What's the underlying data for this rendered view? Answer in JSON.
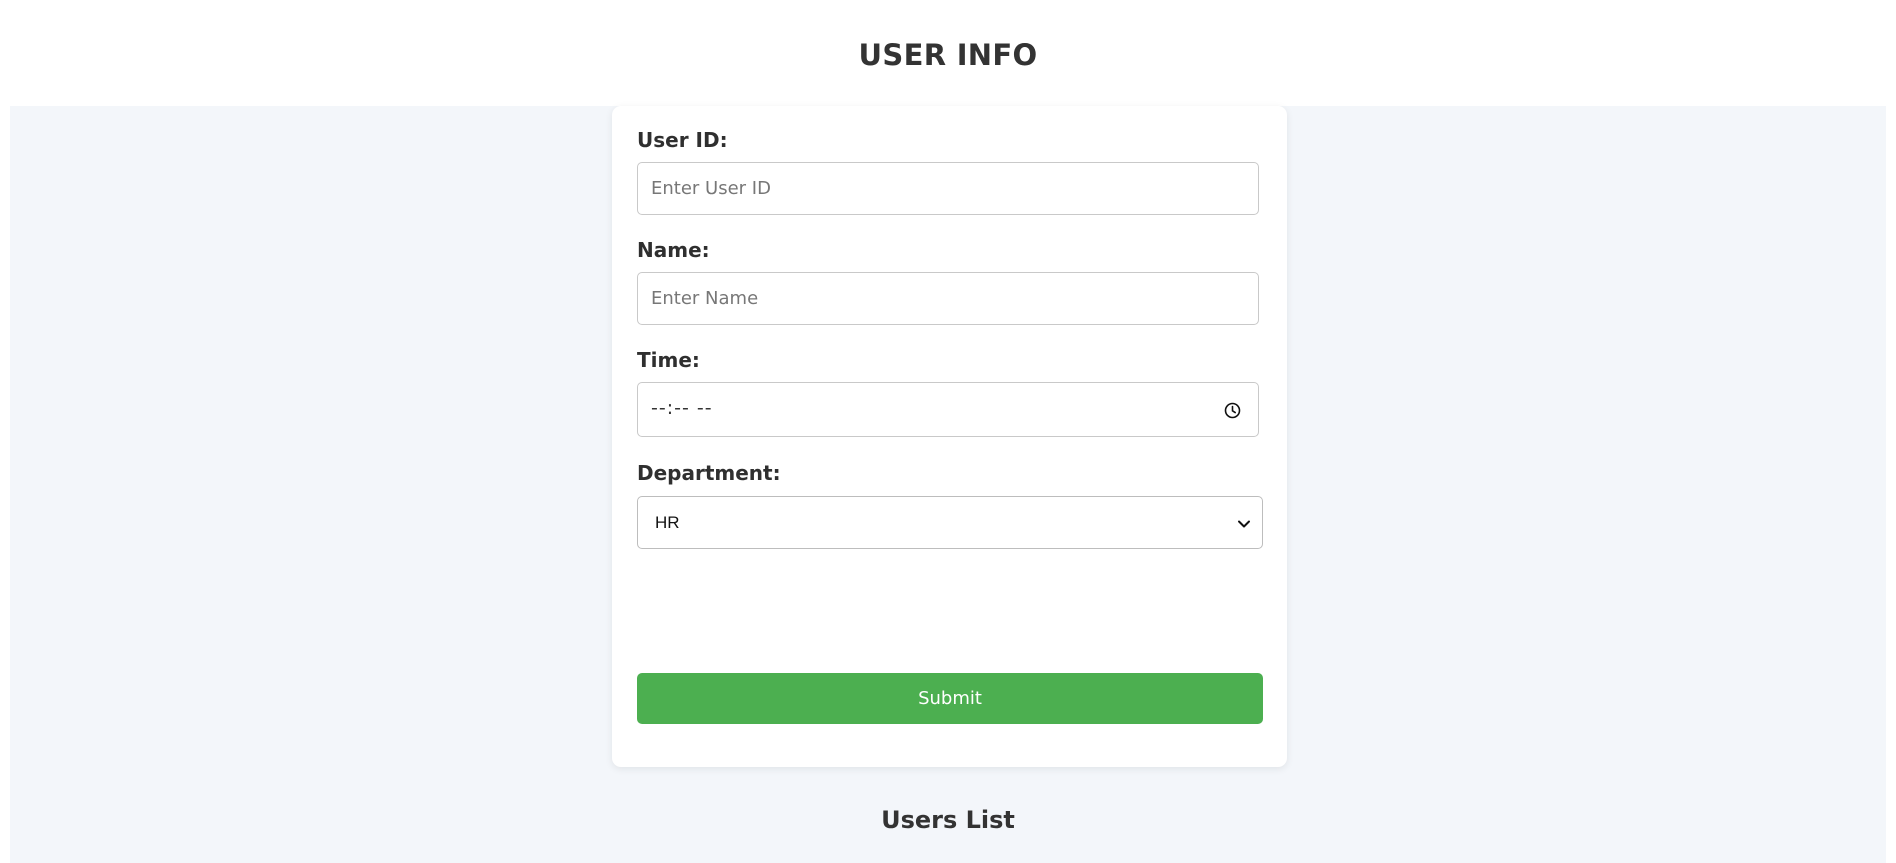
{
  "header": {
    "title": "USER INFO"
  },
  "form": {
    "user_id": {
      "label": "User ID:",
      "placeholder": "Enter User ID",
      "value": ""
    },
    "name": {
      "label": "Name:",
      "placeholder": "Enter Name",
      "value": ""
    },
    "time": {
      "label": "Time:",
      "value": "--:-- --",
      "icon": "clock-icon"
    },
    "department": {
      "label": "Department:",
      "selected": "HR",
      "icon": "chevron-down-icon"
    },
    "submit_label": "Submit"
  },
  "users_list": {
    "heading": "Users List"
  },
  "colors": {
    "background": "#f3f6fa",
    "card": "#ffffff",
    "submit": "#4caf50",
    "text": "#333333"
  }
}
